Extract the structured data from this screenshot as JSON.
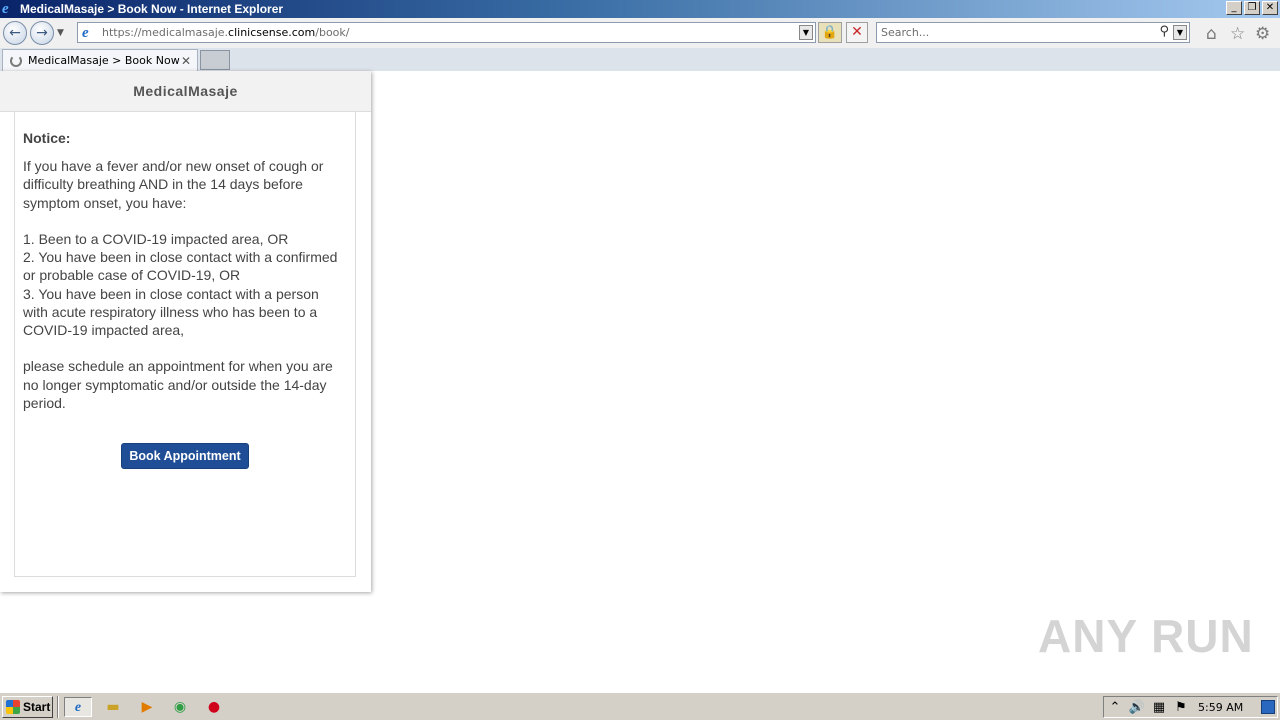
{
  "window": {
    "title": "MedicalMasaje > Book Now - Internet Explorer",
    "buttons": {
      "minimize": "_",
      "restore": "❐",
      "close": "✕"
    }
  },
  "navbar": {
    "back_glyph": "←",
    "forward_glyph": "→",
    "url_prefix": "https://medicalmasaje.",
    "url_host": "clinicsense.com",
    "url_path": "/book/",
    "search_placeholder": "Search...",
    "icons": [
      "back-icon",
      "forward-icon",
      "page-icon",
      "lock-icon",
      "stop-icon",
      "search-icon",
      "home-icon",
      "favorites-icon",
      "settings-icon"
    ]
  },
  "tabs": [
    {
      "label": "MedicalMasaje > Book Now",
      "loading": true
    }
  ],
  "widget": {
    "header": "MedicalMasaje",
    "notice_title": "Notice:",
    "intro": "If you have a fever and/or new onset of cough or difficulty breathing AND in the 14 days before symptom onset, you have:",
    "items": [
      "1. Been to a COVID-19 impacted area, OR",
      "2. You have been in close contact with a confirmed or probable case of COVID-19, OR",
      "3. You have been in close contact with a person with acute respiratory illness who has been to a COVID-19 impacted area,"
    ],
    "closing": "please schedule an appointment for when you are no longer symptomatic and/or outside the 14-day period.",
    "button_label": "Book Appointment",
    "button_color": "#1f4e96"
  },
  "watermark": "ANY RUN",
  "taskbar": {
    "start_label": "Start",
    "quick_launch": [
      "internet-explorer-icon",
      "folder-icon",
      "media-player-icon",
      "chrome-icon",
      "antivirus-icon"
    ],
    "tray_icons": [
      "show-hidden-icon",
      "volume-icon",
      "network-icon",
      "action-center-flag-icon"
    ],
    "clock": "5:59 AM"
  }
}
